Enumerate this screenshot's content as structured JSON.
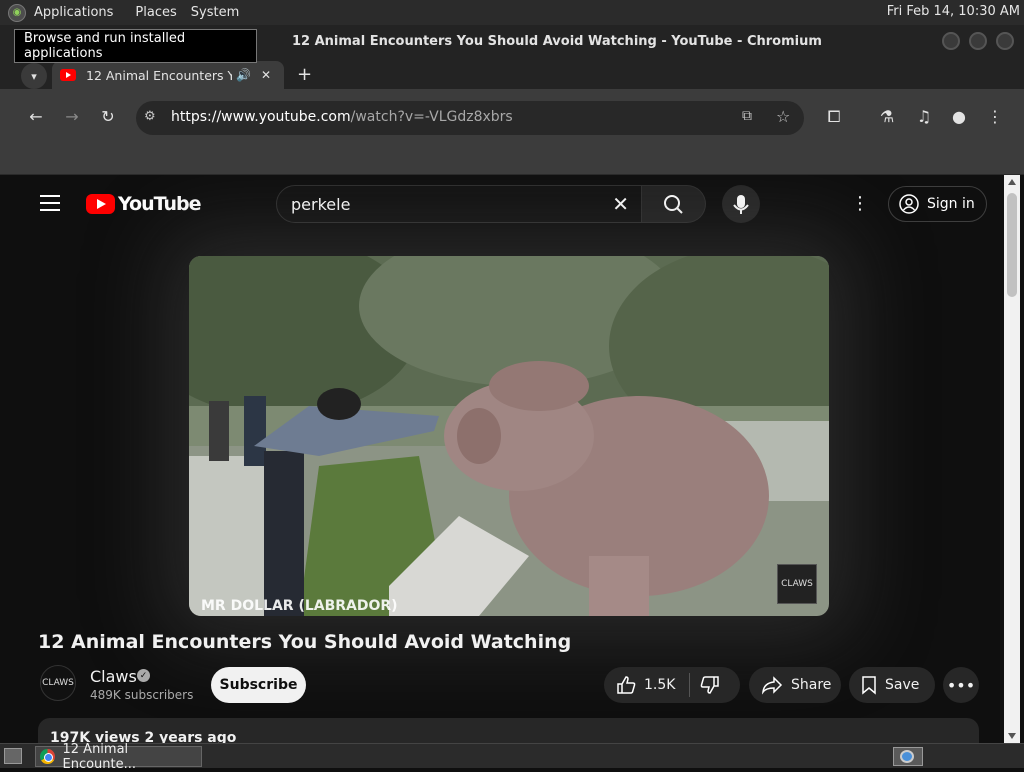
{
  "top_panel": {
    "menus": [
      "Applications",
      "Places",
      "System"
    ],
    "clock": "Fri Feb 14, 10:30 AM",
    "tooltip": "Browse and run installed applications"
  },
  "window": {
    "title": "12 Animal Encounters You Should Avoid Watching - YouTube - Chromium"
  },
  "tabs": [
    {
      "title": "12 Animal Encounters You Should Avoid Watching - YouTube",
      "active": true,
      "audio": true
    }
  ],
  "toolbar": {
    "url_host": "https://www.youtube.com",
    "url_path": "/watch?v=-VLGdz8xbrs"
  },
  "youtube": {
    "logo_text": "YouTube",
    "search_value": "perkele",
    "sign_in_label": "Sign in",
    "video": {
      "title": "12 Animal Encounters You Should Avoid Watching",
      "watermark": "MR DOLLAR (LABRADOR)",
      "badge": "CLAWS"
    },
    "channel": {
      "name": "Claws",
      "avatar_text": "CLAWS",
      "subscribers": "489K subscribers",
      "subscribe_label": "Subscribe"
    },
    "actions": {
      "likes": "1.5K",
      "share_label": "Share",
      "save_label": "Save"
    },
    "description": {
      "views_line": "197K views  2 years ago"
    }
  },
  "taskbar": {
    "task_label": "12 Animal Encounte..."
  }
}
